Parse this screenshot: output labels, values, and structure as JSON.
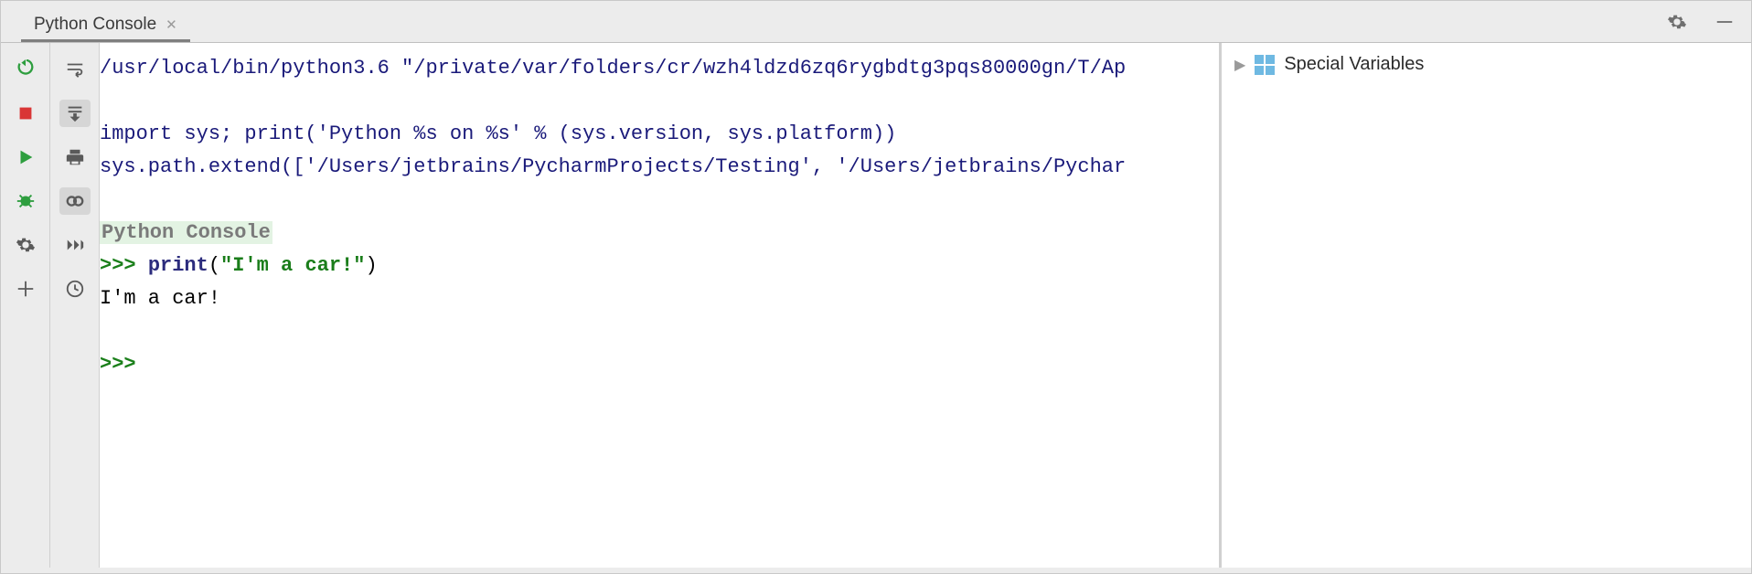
{
  "tab": {
    "label": "Python Console"
  },
  "console": {
    "interpreter_line": "/usr/local/bin/python3.6 \"/private/var/folders/cr/wzh4ldzd6zq6rygbdtg3pqs80000gn/T/Ap",
    "import_line": "import sys; print('Python %s on %s' % (sys.version, sys.platform))",
    "syspath_line": "sys.path.extend(['/Users/jetbrains/PycharmProjects/Testing', '/Users/jetbrains/Pychar",
    "banner": "Python Console",
    "prompt": ">>> ",
    "call_fn": "print",
    "call_open": "(",
    "call_str": "\"I'm a car!\"",
    "call_close": ")",
    "output": "I'm a car!",
    "prompt2": ">>> "
  },
  "variables": {
    "section": "Special Variables"
  },
  "icons": {
    "rerun": "rerun",
    "stop": "stop",
    "run": "run",
    "debug": "debug",
    "settings": "settings",
    "add": "add",
    "softwrap": "softwrap",
    "scroll_to_end": "scroll-to-end",
    "print": "print",
    "var_watch": "var-watch",
    "history_exec": "history-exec",
    "history": "history",
    "gear": "gear",
    "minimize": "minimize"
  }
}
